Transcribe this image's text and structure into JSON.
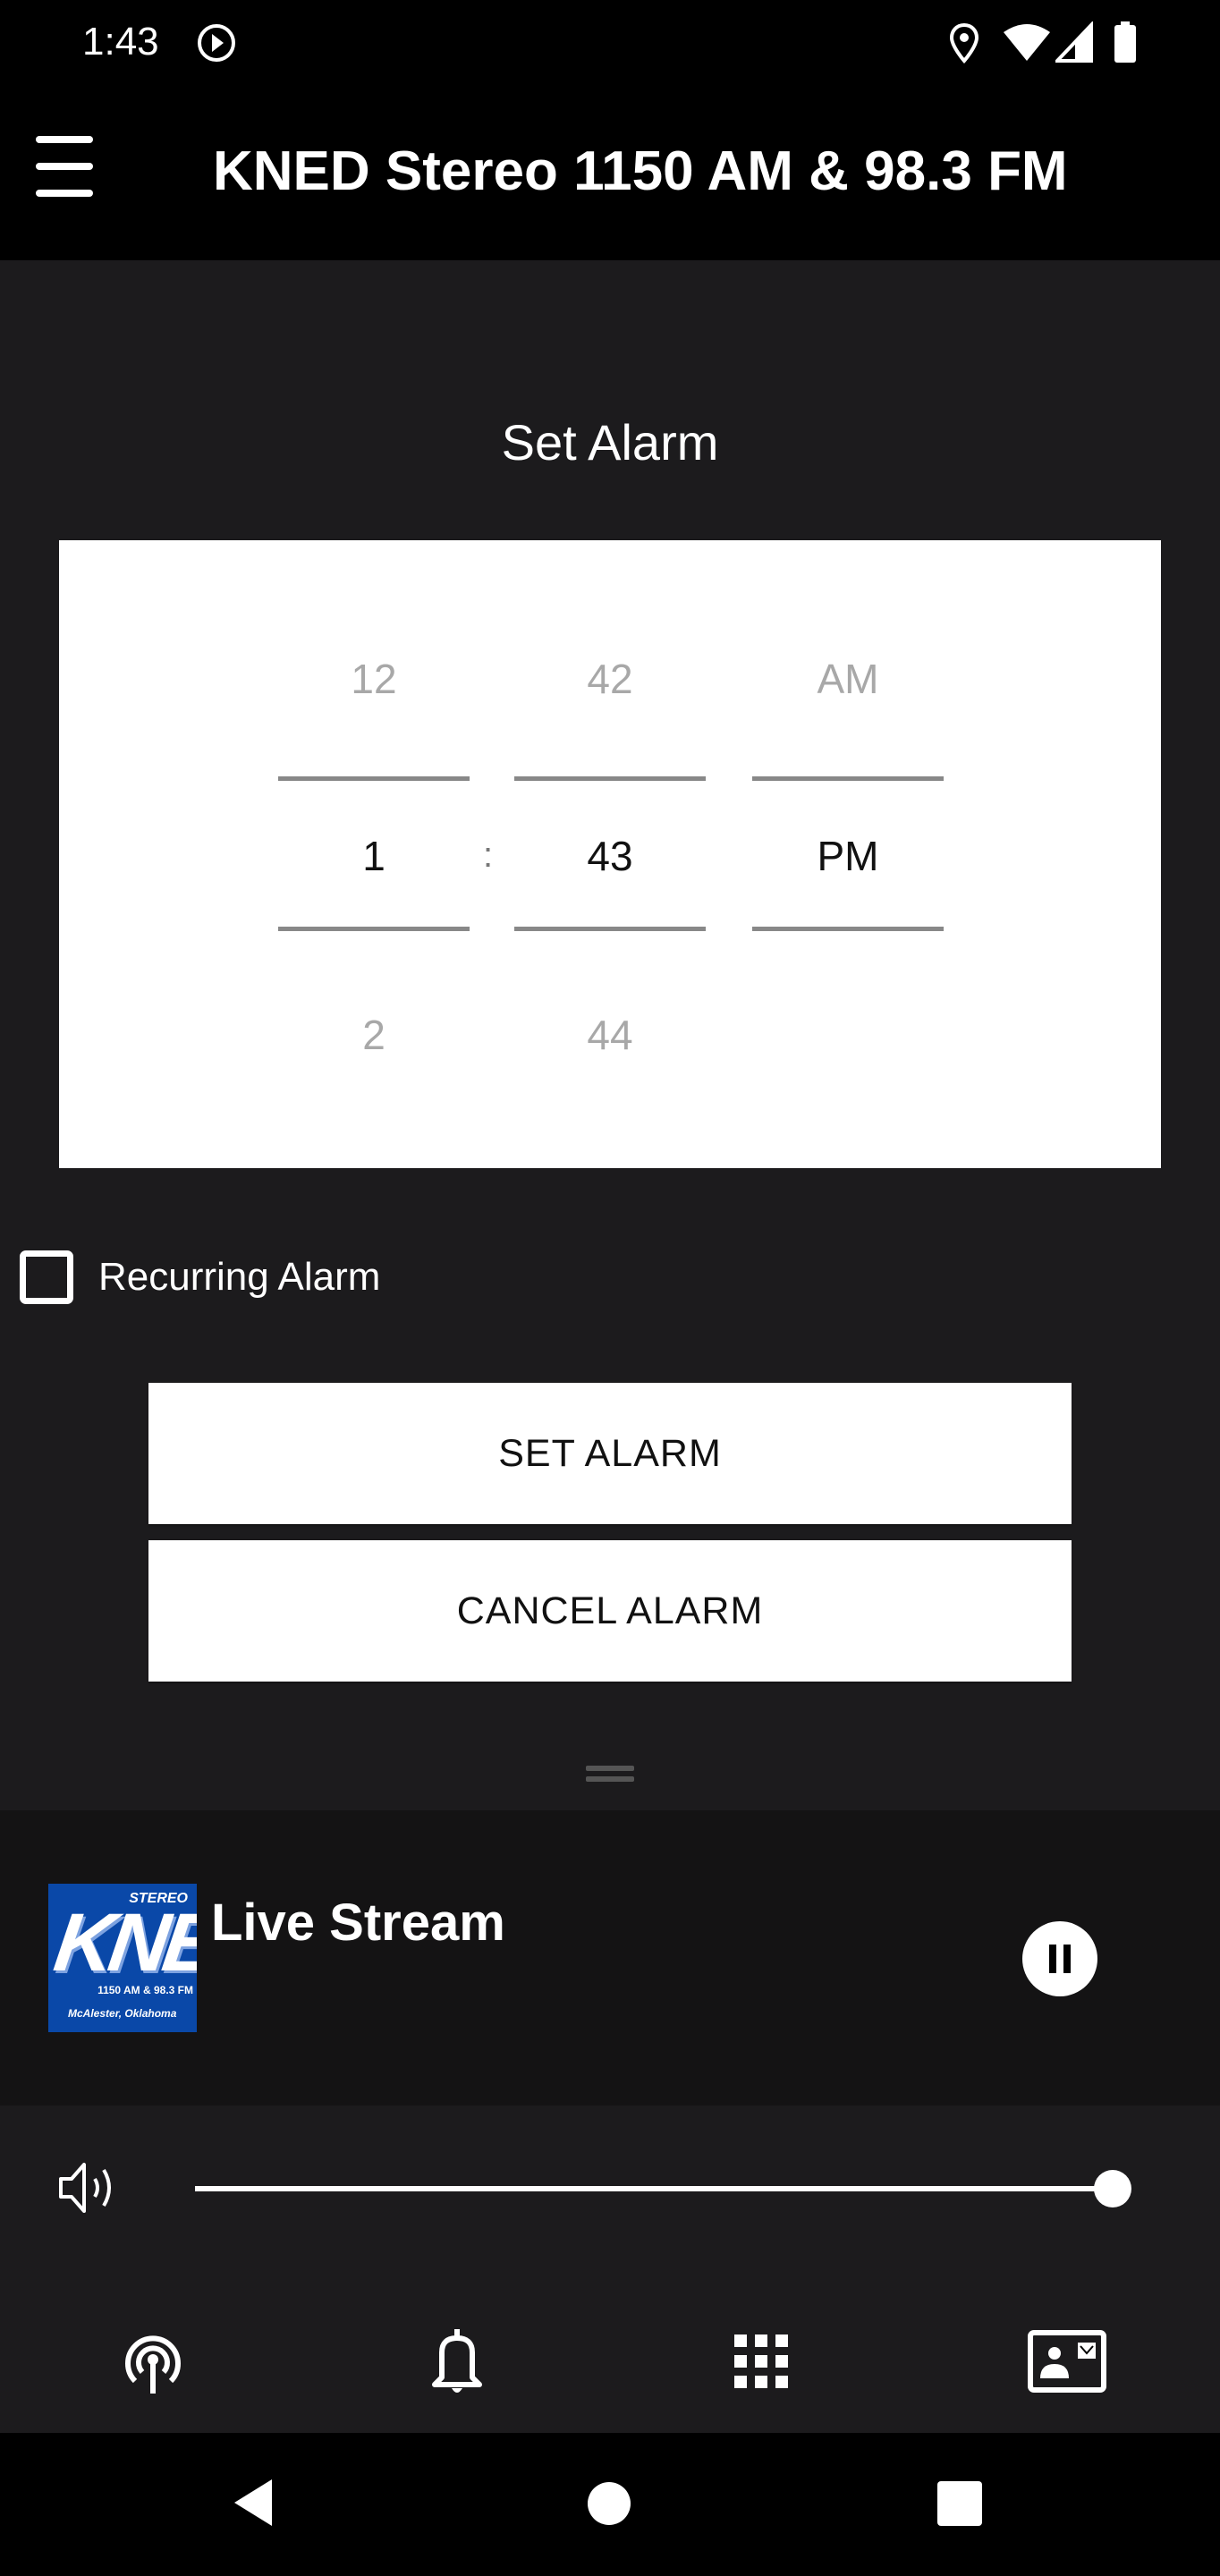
{
  "status_bar": {
    "time": "1:43",
    "icons": [
      "play-circle-icon",
      "location-icon",
      "wifi-icon",
      "signal-icon",
      "battery-icon"
    ]
  },
  "app_bar": {
    "menu_icon": "hamburger-menu-icon",
    "title": "KNED Stereo 1150 AM & 98.3 FM"
  },
  "alarm": {
    "heading": "Set Alarm",
    "picker": {
      "hour": {
        "prev": "12",
        "current": "1",
        "next": "2"
      },
      "separator": ":",
      "minute": {
        "prev": "42",
        "current": "43",
        "next": "44"
      },
      "ampm": {
        "prev": "AM",
        "current": "PM",
        "next": ""
      }
    },
    "recurring": {
      "label": "Recurring Alarm",
      "checked": false
    },
    "set_button": "SET ALARM",
    "cancel_button": "CANCEL ALARM"
  },
  "player": {
    "logo": {
      "main": "KNED",
      "stereo": "STEREO",
      "frequency": "1150 AM & 98.3 FM",
      "city": "McAlester, Oklahoma"
    },
    "title": "Live Stream",
    "state": "playing",
    "control_icon": "pause-icon",
    "volume": 1.0
  },
  "bottom_nav": [
    {
      "name": "live",
      "icon": "podcast-antenna-icon"
    },
    {
      "name": "alarm",
      "icon": "bell-icon"
    },
    {
      "name": "menu-grid",
      "icon": "grid-icon"
    },
    {
      "name": "contact",
      "icon": "contact-card-icon"
    }
  ],
  "system_nav": [
    "back-icon",
    "home-icon",
    "recents-icon"
  ],
  "colors": {
    "background": "#1c1b1d",
    "bars": "#000000",
    "player_bg": "#141314",
    "logo_blue": "#0a48a8"
  }
}
